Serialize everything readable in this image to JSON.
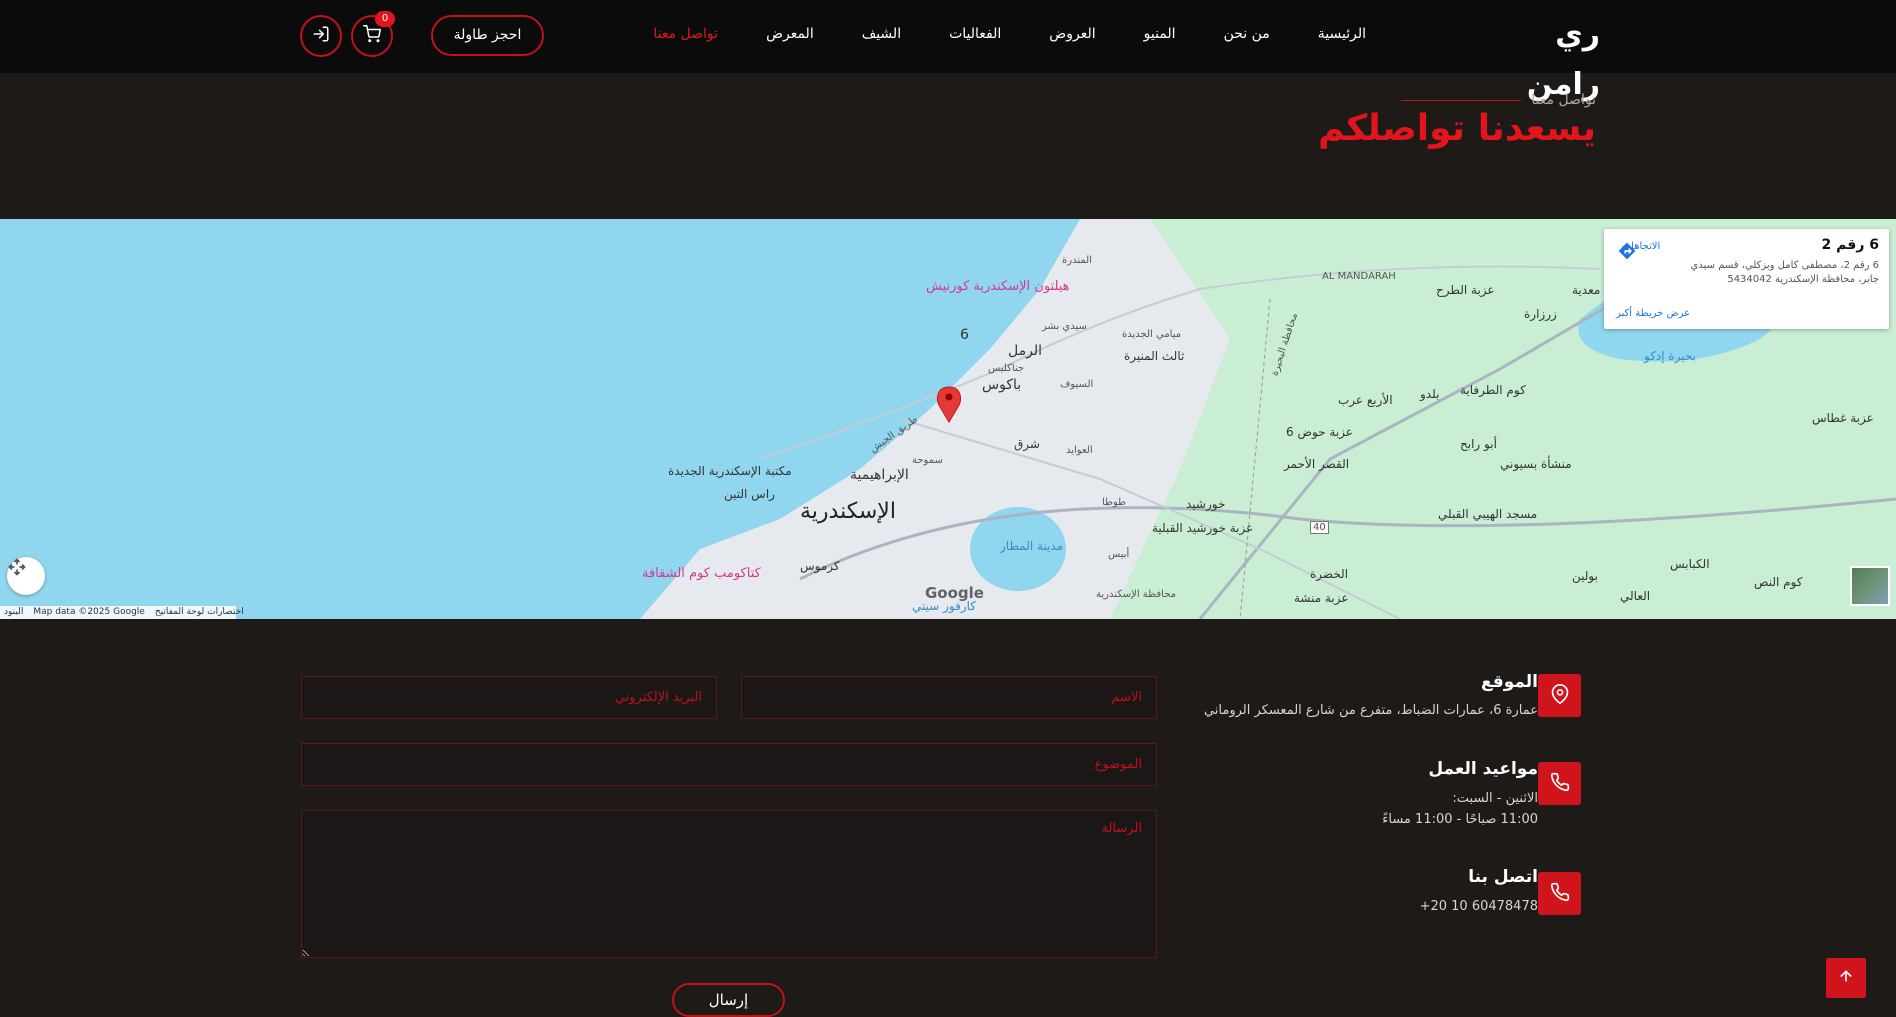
{
  "header": {
    "logo": "ري رامن",
    "nav": [
      "الرئيسية",
      "من نحن",
      "المنيو",
      "العروض",
      "الفعاليات",
      "الشيف",
      "المعرض",
      "تواصل معنا"
    ],
    "active_nav": "تواصل معنا",
    "book_label": "احجز طاولة",
    "cart_count": "0",
    "icons": {
      "cart": "cart-icon",
      "login": "login-icon"
    }
  },
  "heading": {
    "eyebrow": "تواصل معنا",
    "title": "يسعدنا تواصلكم"
  },
  "map": {
    "card": {
      "title": "6 رقم 2",
      "address": "6 رقم 2، مصطفى كامل وبزكلي، قسم سيدي جابر، محافظة الإسكندرية 5434042",
      "directions": "الاتجاهات",
      "larger_map": "عرض خريطة أكبر"
    },
    "pin_label": "6",
    "labels": {
      "alexandria": "الإسكندرية",
      "raml": "الرمل",
      "bakos": "باكوس",
      "ibrahimia": "الإبراهيمية",
      "ras_tin": "راس التين",
      "karmus": "كرموس",
      "shark": "شرق",
      "library": "مكتبة الإسكندرية الجديدة",
      "hilton": "هيلتون الإسكندرية كورنيش",
      "kom_shoqafa": "كتاكومب كوم الشقافة",
      "carrefour": "كارفور سيتي",
      "airport_lake": "مدينة المطار",
      "mandarah": "AL MANDARAH",
      "izbet_tarh": "عزبة الطرح",
      "zarzara": "زرزارة",
      "idku_lake": "بحيرة إدكو",
      "kom_tarfaya": "كوم الطرفاية",
      "baldo": "بلدو",
      "arbaa_arab": "الأربع عرب",
      "izbet_hos": "عزبة حوض 6",
      "qasr_ahmar": "القصر الأحمر",
      "abu_rabee": "أبو رابح",
      "mansheyat_basyouni": "منشأة بسيوني",
      "ghatas": "عزبة غطاس",
      "maadia": "معدية",
      "mosque": "مسجد الهيبي القبلي",
      "khorshid": "خورشيد",
      "khorshid_qibleya": "عزبة خورشيد القبلية",
      "khadra": "الخضرة",
      "manshaa": "عزبة منشة",
      "kabasy": "الكبابس",
      "bolin": "بولين",
      "aly": "العالي",
      "kom_nos": "كوم النص",
      "gov_alex": "محافظة الإسكندرية",
      "gov_beheira": "محافظة البحيرة",
      "miami": "ميامي الجديدة",
      "sidi_bishr": "سيدي بشر",
      "mondara": "المندرة",
      "victoria": "جناكليس",
      "siouf": "السيوف",
      "awaed": "العوايد",
      "smouha": "سموحة",
      "third_mounira": "ثالث المنيرة",
      "tarik_gaish": "طريق الجيش",
      "tota": "طوطا",
      "abis": "أبيس",
      "road40": "40"
    },
    "google": "Google",
    "footer": [
      "البنود",
      "Map data ©2025 Google",
      "اختصارات لوحة المفاتيح"
    ]
  },
  "contact": {
    "location": {
      "title": "الموقع",
      "text": "عمارة 6، عمارات الضباط، متفرع من شارع المعسكر الروماني"
    },
    "hours": {
      "title": "مواعيد العمل",
      "line1": "الاثنين - السبت:",
      "line2": "11:00 صباحًا - 11:00 مساءً"
    },
    "phone": {
      "title": "اتصل بنا",
      "text": "+20 10 60478478"
    }
  },
  "form": {
    "name_placeholder": "الاسم",
    "email_placeholder": "البريد الإلكتروني",
    "subject_placeholder": "الموضوع",
    "message_placeholder": "الرسالة",
    "send_label": "إرسال"
  },
  "colors": {
    "accent": "#e2141c",
    "background": "#1e1a18",
    "header": "#0c0b0b",
    "map_water": "#8fd6ee",
    "map_land": "#e8ecef",
    "map_green": "#c6ecd1"
  }
}
